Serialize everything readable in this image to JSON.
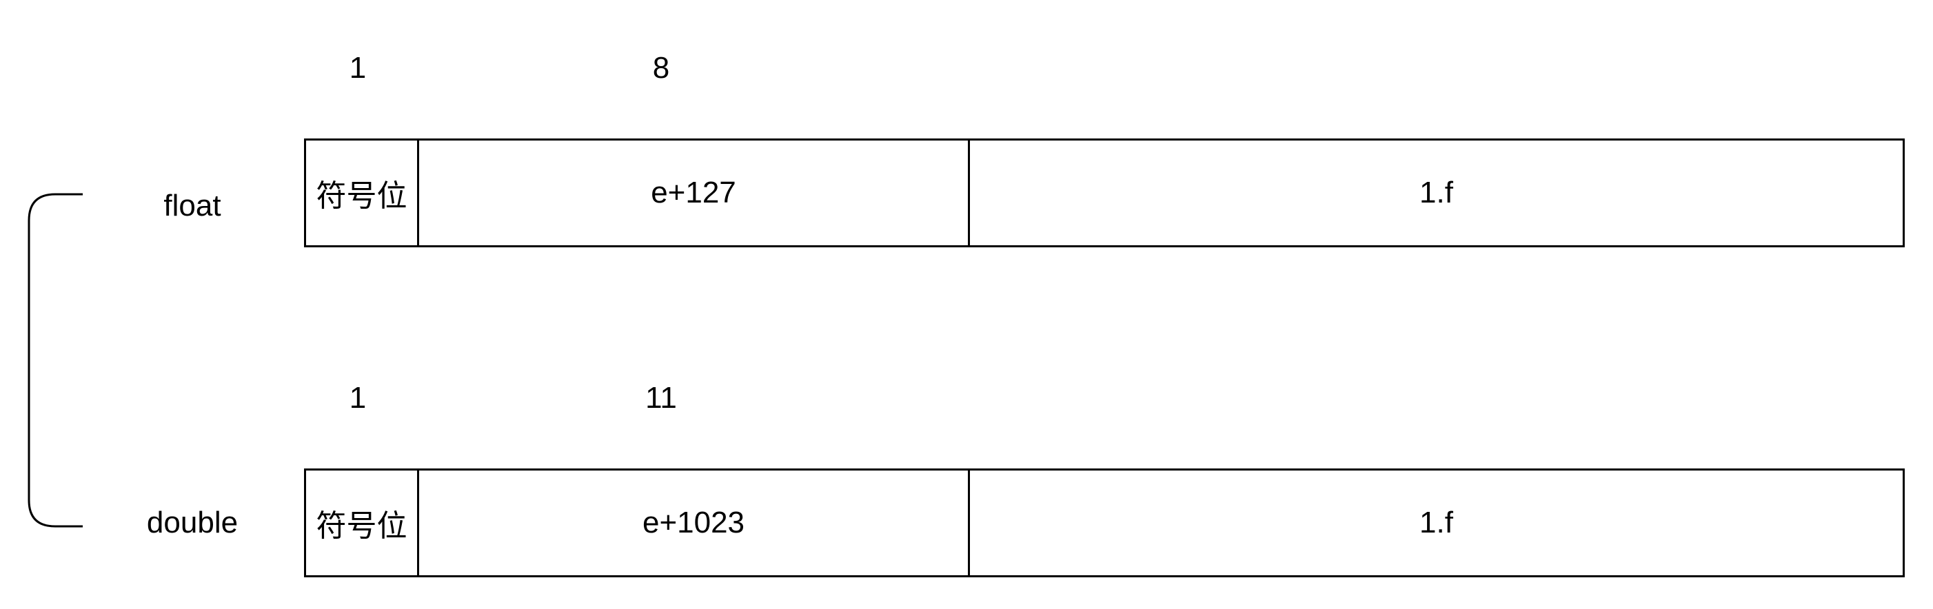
{
  "diagram": {
    "float": {
      "type_label": "float",
      "bits_sign": "1",
      "bits_exponent": "8",
      "sign_cell": "符号位",
      "exponent_cell": "e+127",
      "mantissa_cell": "1.f"
    },
    "double": {
      "type_label": "double",
      "bits_sign": "1",
      "bits_exponent": "11",
      "sign_cell": "符号位",
      "exponent_cell": "e+1023",
      "mantissa_cell": "1.f"
    }
  }
}
